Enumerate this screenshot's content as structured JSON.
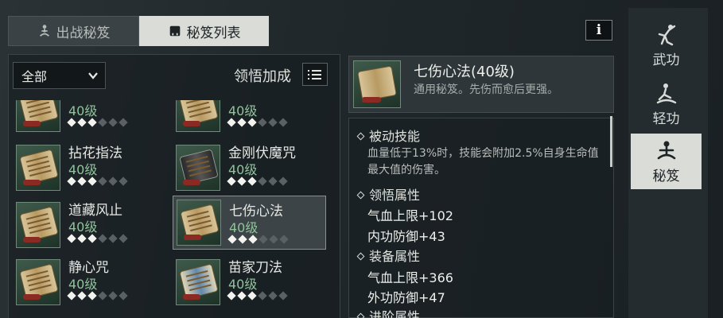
{
  "tabs": [
    {
      "label": "出战秘笈",
      "icon": "meditate-icon",
      "active": false
    },
    {
      "label": "秘笈列表",
      "icon": "book-icon",
      "active": true
    }
  ],
  "info_button": "i",
  "filter": {
    "selected": "全部"
  },
  "sort_label": "领悟加成",
  "cards": [
    {
      "name": "",
      "level": "40级",
      "stars_filled": 3,
      "stars_total": 6,
      "thumb": "scroll"
    },
    {
      "name": "",
      "level": "40级",
      "stars_filled": 3,
      "stars_total": 6,
      "thumb": "scroll"
    },
    {
      "name": "拈花指法",
      "level": "40级",
      "stars_filled": 3,
      "stars_total": 6,
      "thumb": "book"
    },
    {
      "name": "金刚伏魔咒",
      "level": "40级",
      "stars_filled": 3,
      "stars_total": 6,
      "thumb": "dark"
    },
    {
      "name": "道藏风止",
      "level": "40级",
      "stars_filled": 3,
      "stars_total": 6,
      "thumb": "scroll"
    },
    {
      "name": "七伤心法",
      "level": "40级",
      "stars_filled": 3,
      "stars_total": 6,
      "thumb": "book",
      "selected": true
    },
    {
      "name": "静心咒",
      "level": "40级",
      "stars_filled": 3,
      "stars_total": 6,
      "thumb": "scroll"
    },
    {
      "name": "苗家刀法",
      "level": "40级",
      "stars_filled": 3,
      "stars_total": 6,
      "thumb": "blue"
    }
  ],
  "detail": {
    "title": "七伤心法(40级)",
    "subtitle": "通用秘笈。先伤而愈后更强。",
    "passive_header": "被动技能",
    "passive_desc": "血量低于13%时，技能会附加2.5%自身生命值最大值的伤害。",
    "comprehend_header": "领悟属性",
    "comprehend_attrs": [
      "气血上限+102",
      "内功防御+43"
    ],
    "equip_header": "装备属性",
    "equip_attrs": [
      "气血上限+366",
      "外功防御+47"
    ],
    "advance_header": "进阶属性"
  },
  "rail": [
    {
      "label": "武功",
      "icon": "martial-pose-icon",
      "active": false
    },
    {
      "label": "轻功",
      "icon": "lightfoot-icon",
      "active": false
    },
    {
      "label": "秘笈",
      "icon": "meditate-icon",
      "active": true
    }
  ],
  "colors": {
    "level_green": "#8fc39a",
    "tab_active_bg": "#d9dcd7"
  }
}
